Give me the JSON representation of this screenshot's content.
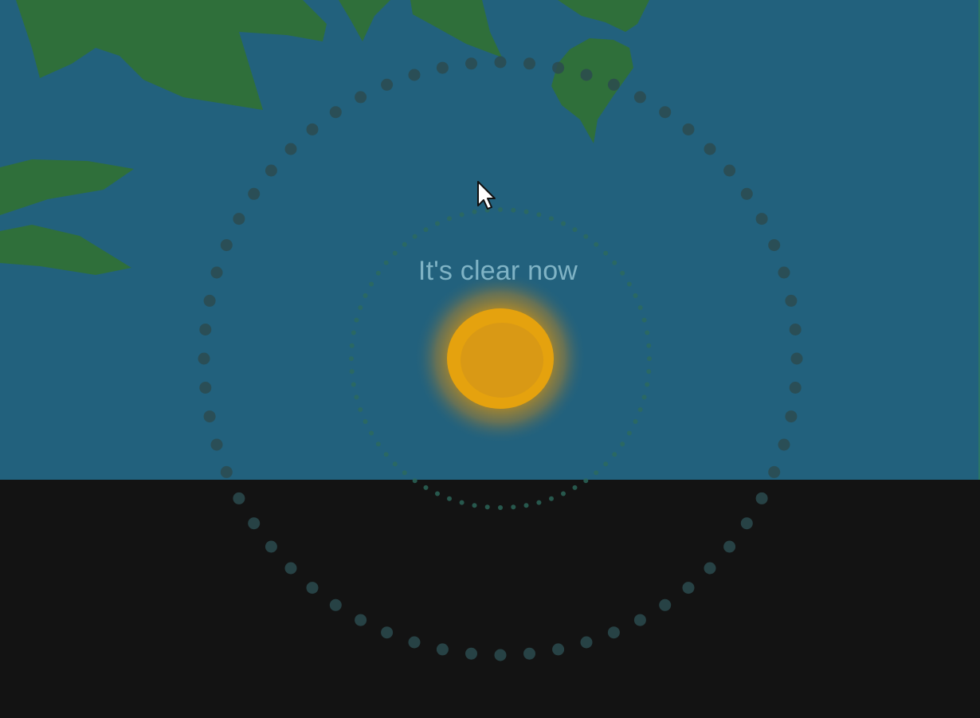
{
  "weather": {
    "status_text": "It's clear now",
    "condition": "clear"
  },
  "colors": {
    "sky": "#22617d",
    "ground": "#131313",
    "foliage": "#2f6f3a",
    "sun_core": "#e5a20e",
    "sun_glow": "#c98e1f",
    "orbit_dots_outer": "#2c4b4f",
    "orbit_dots_inner": "#2d6a5c",
    "status_text": "#7fb3c5",
    "edge_accent": "#2f7c5c"
  },
  "icons": {
    "sun": "sun-icon",
    "cursor": "mouse-pointer-icon"
  }
}
